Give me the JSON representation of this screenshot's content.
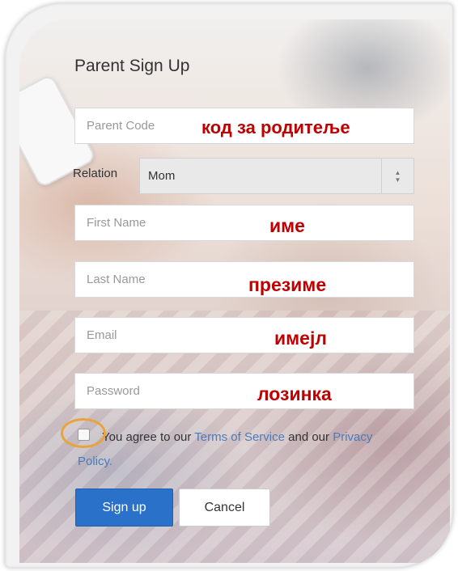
{
  "form": {
    "title": "Parent Sign Up",
    "parent_code": {
      "placeholder": "Parent Code",
      "annotation": "код за родитеље"
    },
    "relation": {
      "label": "Relation",
      "selected": "Mom"
    },
    "first_name": {
      "placeholder": "First Name",
      "annotation": "име"
    },
    "last_name": {
      "placeholder": "Last Name",
      "annotation": "презиме"
    },
    "email": {
      "placeholder": "Email",
      "annotation": "имејл"
    },
    "password": {
      "placeholder": "Password",
      "annotation": "лозинка"
    },
    "agreement": {
      "text_before": "You agree to our ",
      "terms_link": "Terms of Service",
      "text_middle": " and our ",
      "privacy_link": "Privacy Policy.",
      "checked": false
    },
    "buttons": {
      "sign_up": "Sign up",
      "cancel": "Cancel"
    }
  },
  "colors": {
    "primary_button": "#2a72c9",
    "annotation_text": "#c00000",
    "link": "#4a7bbd",
    "highlight_ring": "#e8a43a"
  },
  "icons": {
    "select_arrows": "up-down-chevron-icon"
  }
}
